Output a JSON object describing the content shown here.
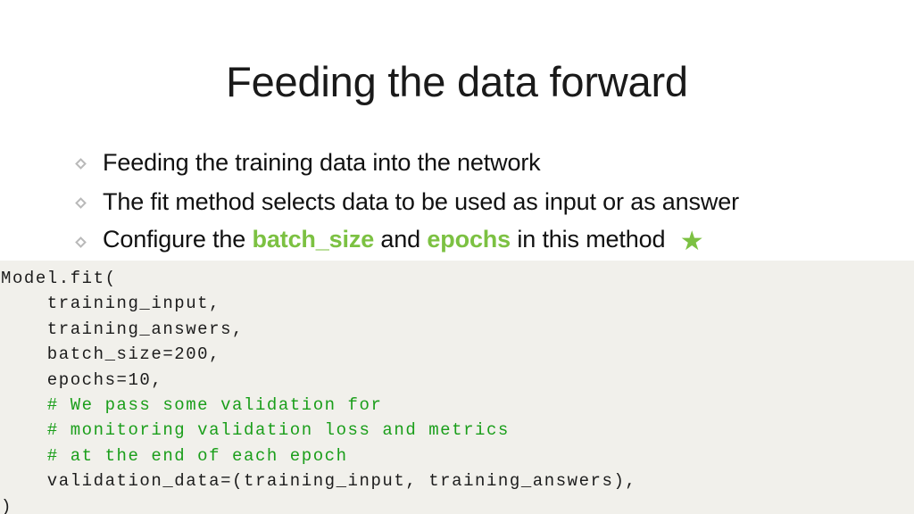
{
  "slide": {
    "title": "Feeding the data forward",
    "background_color": "#ffffff",
    "accent_color": "#7cc142"
  },
  "bullets": [
    {
      "marker": "diamond-bullet-icon",
      "parts": [
        {
          "text": "Feeding the training data into the network",
          "style": "normal"
        }
      ]
    },
    {
      "marker": "diamond-bullet-icon",
      "parts": [
        {
          "text": "The fit method selects data to be used as input or as answer",
          "style": "normal"
        }
      ]
    },
    {
      "marker": "diamond-bullet-icon",
      "parts": [
        {
          "text": "Configure the ",
          "style": "normal"
        },
        {
          "text": "batch_size",
          "style": "highlight"
        },
        {
          "text": " and ",
          "style": "normal"
        },
        {
          "text": "epochs",
          "style": "highlight"
        },
        {
          "text": " in this method ",
          "style": "normal"
        },
        {
          "text": "★",
          "style": "star"
        }
      ]
    }
  ],
  "bullet_text": {
    "line1": "Feeding the training data into the network",
    "line2": "The fit method selects data to be used as input or as answer",
    "line3_pre": "Configure the ",
    "line3_kw1": "batch_size",
    "line3_mid": " and ",
    "line3_kw2": "epochs",
    "line3_post": " in this method ",
    "line3_star": "★"
  },
  "code_block": {
    "background_color": "#f1f0eb",
    "text_color": "#1c1c1c",
    "comment_color": "#1a9e1a",
    "language": "python",
    "lines": [
      {
        "text": "Model.fit(",
        "type": "code"
      },
      {
        "text": "    training_input,",
        "type": "code"
      },
      {
        "text": "    training_answers,",
        "type": "code"
      },
      {
        "text": "    batch_size=200,",
        "type": "code"
      },
      {
        "text": "    epochs=10,",
        "type": "code"
      },
      {
        "text": "    # We pass some validation for",
        "type": "comment"
      },
      {
        "text": "    # monitoring validation loss and metrics",
        "type": "comment"
      },
      {
        "text": "    # at the end of each epoch",
        "type": "comment"
      },
      {
        "text": "    validation_data=(training_input, training_answers),",
        "type": "code"
      },
      {
        "text": ")",
        "type": "code"
      }
    ]
  }
}
